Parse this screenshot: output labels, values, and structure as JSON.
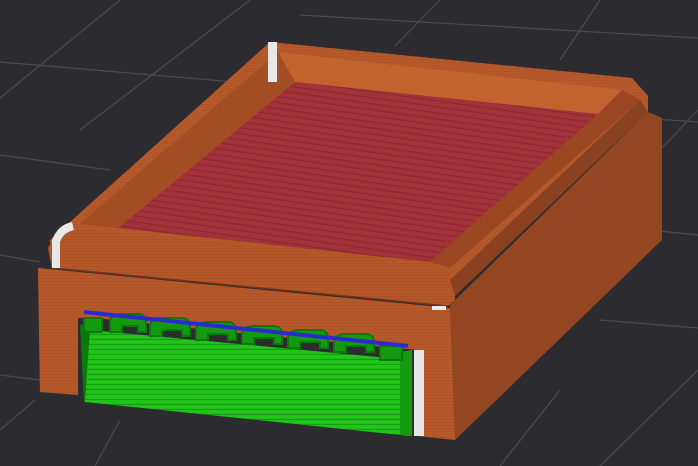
{
  "viewport": {
    "background": "#2b2b30",
    "grid_color": "#4a4a50"
  },
  "model": {
    "shell_color": "#b5582a",
    "shell_dark": "#8a4120",
    "shell_shadow": "#6e3318",
    "floor_color": "#a2323a",
    "support_color": "#22c41c",
    "support_dark": "#139a10",
    "support_deep": "#0c7a0a",
    "bridge_color": "#2a2ad0",
    "seam_color": "#e8e8e8"
  }
}
